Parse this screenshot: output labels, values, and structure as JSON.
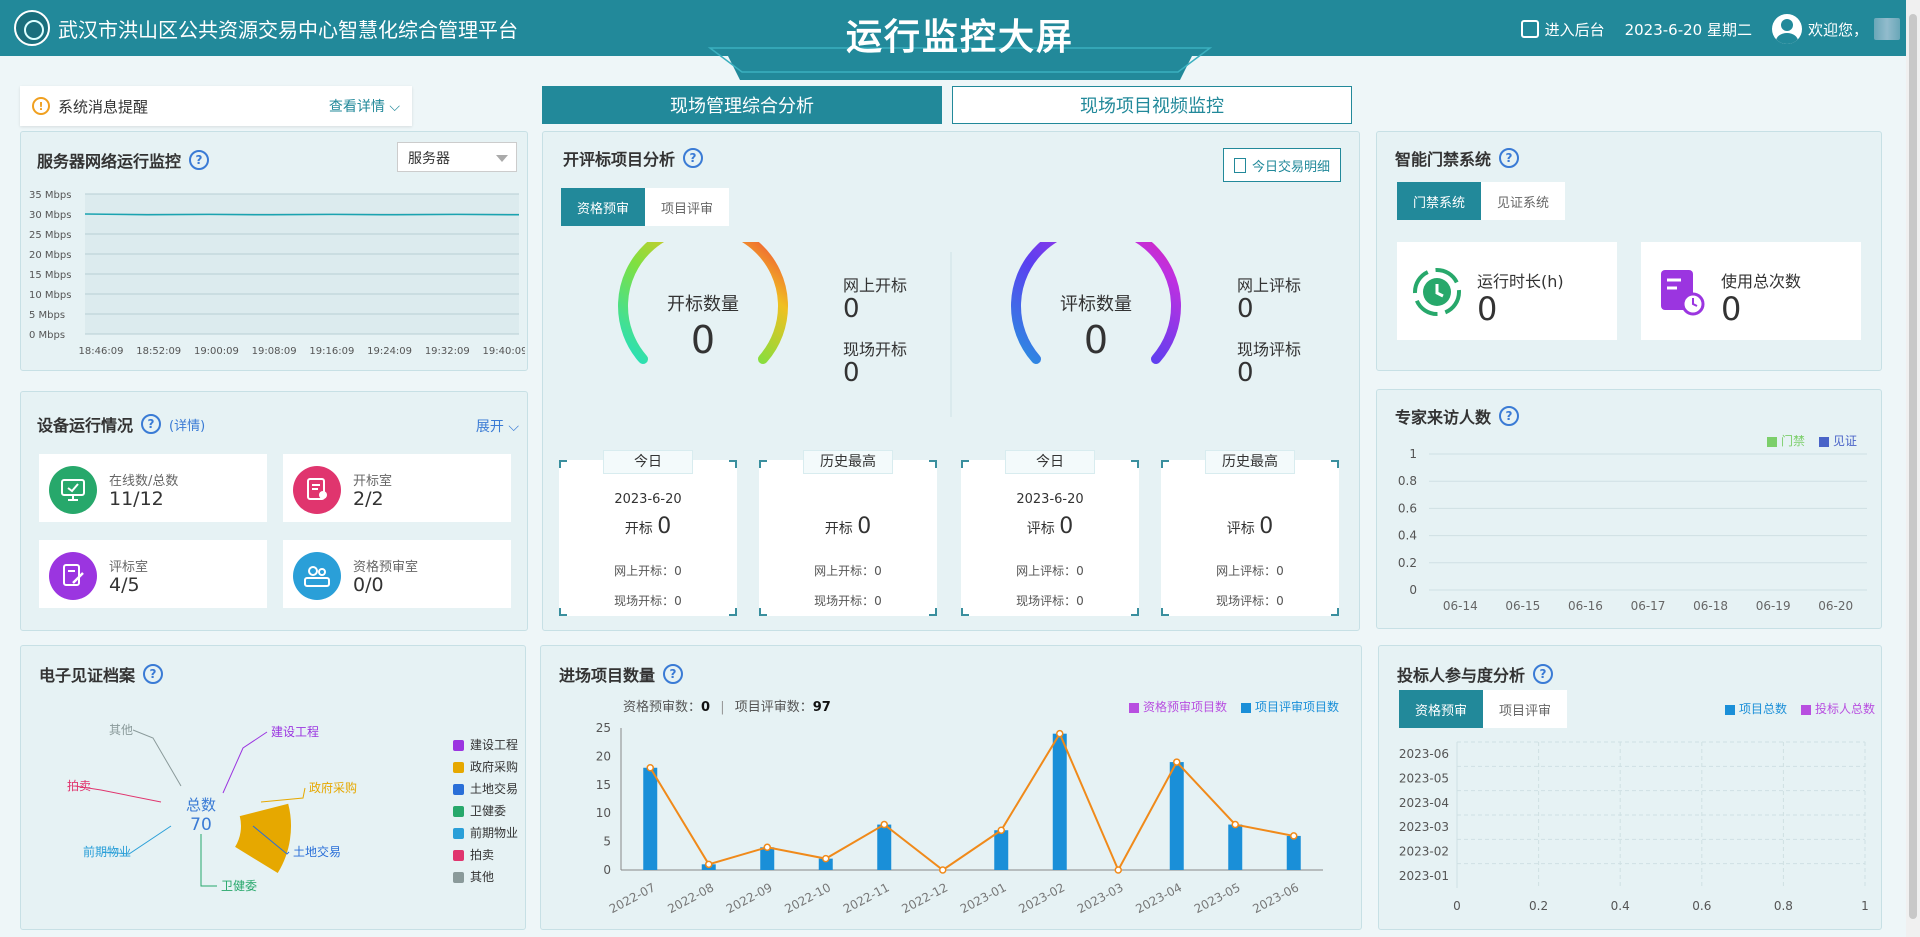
{
  "header": {
    "platform_title": "武汉市洪山区公共资源交易中心智慧化综合管理平台",
    "main_title": "运行监控大屏",
    "enter_admin": "进入后台",
    "date": "2023-6-20 星期二",
    "welcome": "欢迎您，"
  },
  "notice": {
    "text": "系统消息提醒",
    "link": "查看详情"
  },
  "top_tabs": [
    "现场管理综合分析",
    "现场项目视频监控"
  ],
  "server": {
    "title": "服务器网络运行监控",
    "select_value": "服务器",
    "chart_data": {
      "type": "line",
      "ylabels": [
        "35 Mbps",
        "30 Mbps",
        "25 Mbps",
        "20 Mbps",
        "15 Mbps",
        "10 Mbps",
        "5 Mbps",
        "0 Mbps"
      ],
      "ylim": [
        0,
        35
      ],
      "x": [
        "18:46:09",
        "18:52:09",
        "19:00:09",
        "19:08:09",
        "19:16:09",
        "19:24:09",
        "19:32:09",
        "19:40:09"
      ],
      "values": [
        30,
        29.8,
        29.9,
        29.8,
        29.9,
        29.8,
        29.9,
        29.8
      ],
      "color": "#1aa3b0"
    }
  },
  "devices": {
    "title": "设备运行情况",
    "detail": "(详情)",
    "expand": "展开",
    "items": [
      {
        "label": "在线数/总数",
        "value": "11/12",
        "color": "#27a86b"
      },
      {
        "label": "开标室",
        "value": "2/2",
        "color": "#e0356e"
      },
      {
        "label": "评标室",
        "value": "4/5",
        "color": "#9b35e0"
      },
      {
        "label": "资格预审室",
        "value": "0/0",
        "color": "#2a9fd8"
      }
    ]
  },
  "bid": {
    "title": "开评标项目分析",
    "today_btn": "今日交易明细",
    "tabs": [
      "资格预审",
      "项目评审"
    ],
    "open_gauge": {
      "label": "开标数量",
      "value": "0"
    },
    "eval_gauge": {
      "label": "评标数量",
      "value": "0"
    },
    "open_side": [
      {
        "label": "网上开标",
        "value": "0"
      },
      {
        "label": "现场开标",
        "value": "0"
      }
    ],
    "eval_side": [
      {
        "label": "网上评标",
        "value": "0"
      },
      {
        "label": "现场评标",
        "value": "0"
      }
    ],
    "cards": [
      {
        "tag": "今日",
        "date": "2023-6-20",
        "main_label": "开标",
        "main_value": "0",
        "sub1": "网上开标：0",
        "sub2": "现场开标：0"
      },
      {
        "tag": "历史最高",
        "date": "",
        "main_label": "开标",
        "main_value": "0",
        "sub1": "网上开标：0",
        "sub2": "现场开标：0"
      },
      {
        "tag": "今日",
        "date": "2023-6-20",
        "main_label": "评标",
        "main_value": "0",
        "sub1": "网上评标：0",
        "sub2": "现场评标：0"
      },
      {
        "tag": "历史最高",
        "date": "",
        "main_label": "评标",
        "main_value": "0",
        "sub1": "网上评标：0",
        "sub2": "现场评标：0"
      }
    ]
  },
  "door": {
    "title": "智能门禁系统",
    "tabs": [
      "门禁系统",
      "见证系统"
    ],
    "cards": [
      {
        "label": "运行时长(h)",
        "value": "0",
        "color": "#27a86b"
      },
      {
        "label": "使用总次数",
        "value": "0",
        "color": "#9b35e0"
      }
    ]
  },
  "expert": {
    "title": "专家来访人数",
    "chart_data": {
      "type": "bar",
      "categories": [
        "06-14",
        "06-15",
        "06-16",
        "06-17",
        "06-18",
        "06-19",
        "06-20"
      ],
      "ylim": [
        0,
        1
      ],
      "yticks": [
        "1",
        "0.8",
        "0.6",
        "0.4",
        "0.2",
        "0"
      ],
      "series": [
        {
          "name": "门禁",
          "values": [
            0,
            0,
            0,
            0,
            0,
            0,
            0
          ],
          "color": "#7ccf6a"
        },
        {
          "name": "见证",
          "values": [
            0,
            0,
            0,
            0,
            0,
            0,
            0
          ],
          "color": "#4a64c8"
        }
      ]
    }
  },
  "archive": {
    "title": "电子见证档案",
    "total_label": "总数",
    "total_value": "70",
    "chart_data": {
      "type": "pie",
      "categories": [
        "建设工程",
        "政府采购",
        "土地交易",
        "卫健委",
        "前期物业",
        "拍卖",
        "其他"
      ],
      "values": [
        0,
        70,
        0,
        0,
        0,
        0,
        0
      ],
      "colors": [
        "#9b35e0",
        "#e6a800",
        "#2a6fd8",
        "#27a86b",
        "#2a9fd8",
        "#e0356e",
        "#8a9a9a"
      ]
    }
  },
  "entry": {
    "title": "进场项目数量",
    "summary_label1": "资格预审数：",
    "summary_value1": "0",
    "summary_label2": "项目评审数：",
    "summary_value2": "97",
    "chart_data": {
      "type": "bar",
      "categories": [
        "2022-07",
        "2022-08",
        "2022-09",
        "2022-10",
        "2022-11",
        "2022-12",
        "2023-01",
        "2023-02",
        "2023-03",
        "2023-04",
        "2023-05",
        "2023-06"
      ],
      "ylim": [
        0,
        25
      ],
      "yticks": [
        "25",
        "20",
        "15",
        "10",
        "5",
        "0"
      ],
      "series": [
        {
          "name": "资格预审项目数",
          "values": [
            0,
            0,
            0,
            0,
            0,
            0,
            0,
            0,
            0,
            0,
            0,
            0
          ],
          "color": "#b84fe0"
        },
        {
          "name": "项目评审项目数",
          "values": [
            18,
            1,
            4,
            2,
            8,
            0,
            7,
            24,
            0,
            19,
            8,
            6
          ],
          "color": "#1a8fd8"
        }
      ],
      "line_color": "#f08a1a"
    }
  },
  "bidder": {
    "title": "投标人参与度分析",
    "tabs": [
      "资格预审",
      "项目评审"
    ],
    "chart_data": {
      "type": "bar",
      "categories": [
        "2023-06",
        "2023-05",
        "2023-04",
        "2023-03",
        "2023-02",
        "2023-01"
      ],
      "xticks": [
        "0",
        "0.2",
        "0.4",
        "0.6",
        "0.8",
        "1"
      ],
      "xlim": [
        0,
        1
      ],
      "series": [
        {
          "name": "项目总数",
          "values": [
            0,
            0,
            0,
            0,
            0,
            0
          ],
          "color": "#1a8fd8"
        },
        {
          "name": "投标人总数",
          "values": [
            0,
            0,
            0,
            0,
            0,
            0
          ],
          "color": "#b84fe0"
        }
      ]
    }
  }
}
